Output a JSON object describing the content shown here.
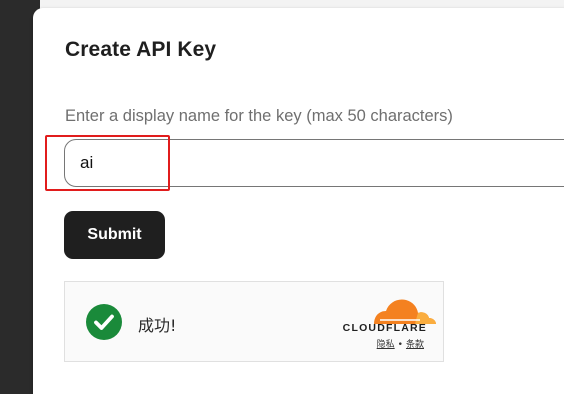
{
  "dialog": {
    "title": "Create API Key",
    "field_label": "Enter a display name for the key (max 50 characters)",
    "name_value": "ai",
    "submit_label": "Submit"
  },
  "turnstile": {
    "status_text": "成功!",
    "brand": "CLOUDFLARE",
    "privacy_label": "隐私",
    "separator": "•",
    "terms_label": "条款",
    "status_icon": "check-circle-icon",
    "status_color": "#1a8a3a",
    "brand_colors": [
      "#f48120",
      "#faad3f"
    ]
  },
  "annotation": {
    "color": "#e11c1c"
  }
}
